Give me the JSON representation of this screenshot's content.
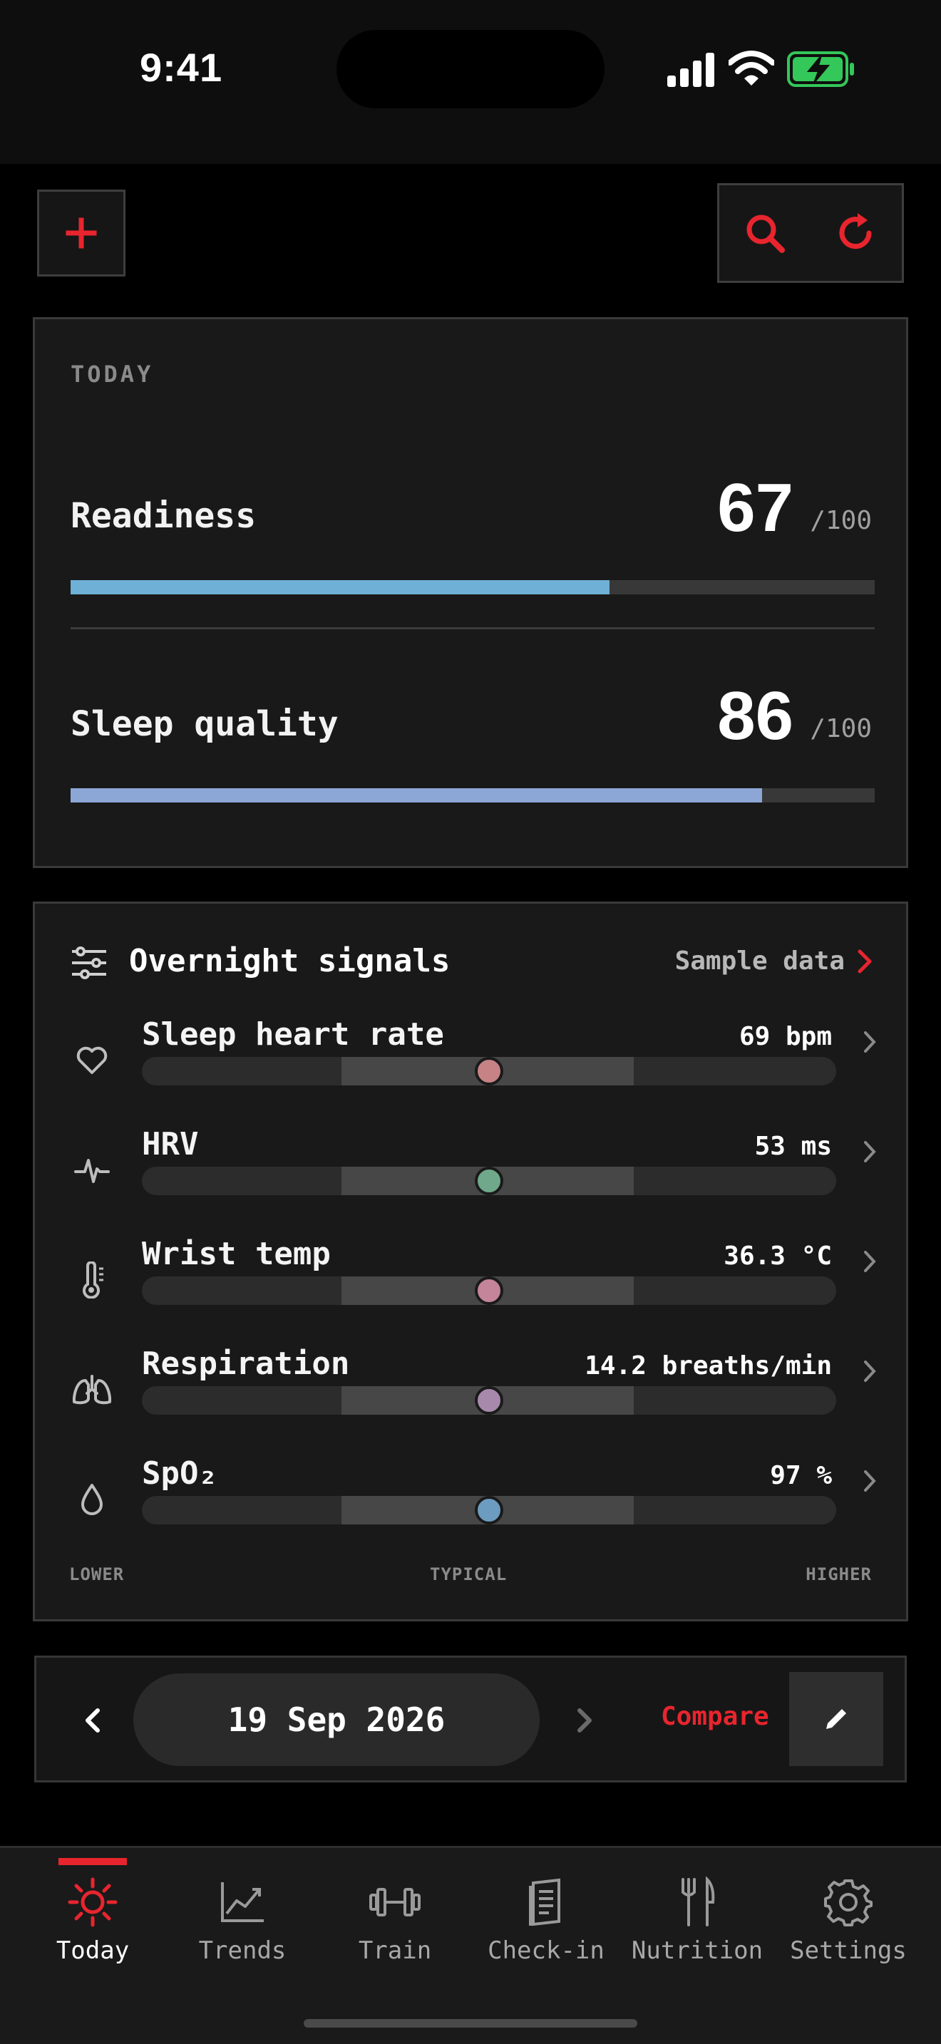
{
  "status": {
    "time": "9:41"
  },
  "today": {
    "section": "TODAY",
    "readiness": {
      "label": "Readiness",
      "value": "67",
      "max": "/100",
      "fraction": 0.67,
      "color": "#6fb0d6"
    },
    "sleep": {
      "label": "Sleep quality",
      "value": "86",
      "max": "/100",
      "fraction": 0.86,
      "color": "#8ca6d6"
    }
  },
  "signals": {
    "title": "Overnight signals",
    "sample_link": "Sample data",
    "rows": [
      {
        "name": "Sleep heart rate",
        "value": "69 bpm",
        "position": 0.5,
        "dot_color": "#c78285",
        "icon": "heart-icon"
      },
      {
        "name": "HRV",
        "value": "53 ms",
        "position": 0.5,
        "dot_color": "#6fa88a",
        "icon": "pulse-icon"
      },
      {
        "name": "Wrist temp",
        "value": "36.3 °C",
        "position": 0.5,
        "dot_color": "#c4849a",
        "icon": "thermometer-icon"
      },
      {
        "name": "Respiration",
        "value": "14.2 breaths/min",
        "position": 0.5,
        "dot_color": "#a78aab",
        "icon": "lungs-icon"
      },
      {
        "name": "SpO₂",
        "value": "97 %",
        "position": 0.5,
        "dot_color": "#6c9cc0",
        "icon": "drop-icon"
      }
    ],
    "scale": {
      "lower": "LOWER",
      "typical": "TYPICAL",
      "higher": "HIGHER"
    }
  },
  "date_nav": {
    "date": "19 Sep 2026",
    "compare": "Compare"
  },
  "tabs": [
    {
      "label": "Today",
      "icon": "sun-icon",
      "active": true
    },
    {
      "label": "Trends",
      "icon": "chart-icon",
      "active": false
    },
    {
      "label": "Train",
      "icon": "dumbbell-icon",
      "active": false
    },
    {
      "label": "Check-in",
      "icon": "journal-icon",
      "active": false
    },
    {
      "label": "Nutrition",
      "icon": "fork-knife-icon",
      "active": false
    },
    {
      "label": "Settings",
      "icon": "gear-icon",
      "active": false
    }
  ],
  "colors": {
    "accent": "#e8252e",
    "battery": "#34c759"
  }
}
